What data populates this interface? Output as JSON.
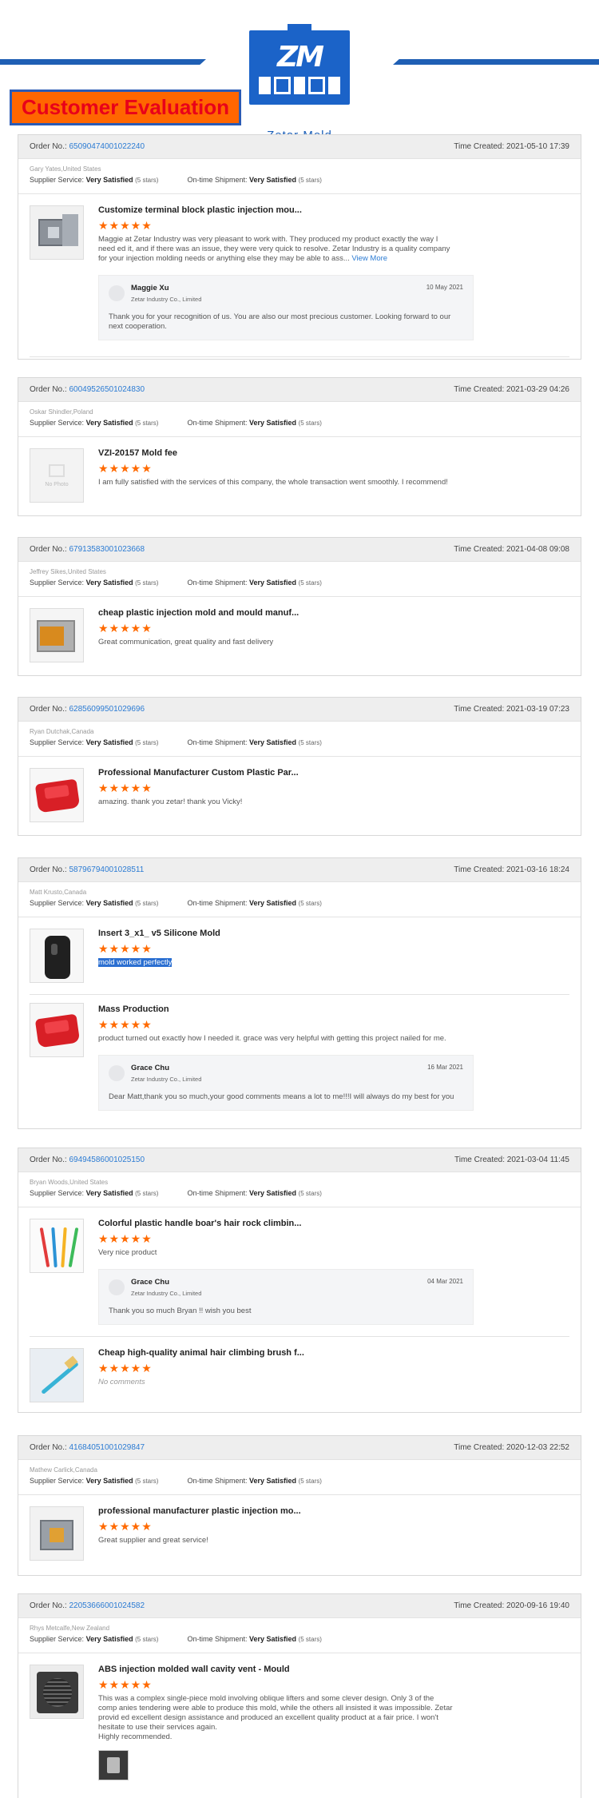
{
  "header": {
    "logo_mark": "ZM",
    "logo_text": "Zetar Mold",
    "banner": "Customer Evaluation"
  },
  "labels": {
    "order_no": "Order No.:",
    "time_created": "Time Created:",
    "supplier_service": "Supplier Service:",
    "ontime_shipment": "On-time Shipment:",
    "view_more": "View More",
    "no_photo": "No Photo"
  },
  "colors": {
    "accent_link": "#2b7bd3",
    "stars": "#ff6a00",
    "banner_bg": "#ff6600",
    "banner_text": "#e8001a",
    "brand_blue": "#1b63c8"
  },
  "orders": [
    {
      "order_no": "65090474001022240",
      "time": "2021-05-10 17:39",
      "buyer": "Gary Yates,United States",
      "supplier_rating": "Very Satisfied",
      "supplier_stars": "(5 stars)",
      "shipment_rating": "On-time Shipment:",
      "shipment_value": "Very Satisfied",
      "shipment_stars": "(5 stars)",
      "items": [
        {
          "thumb_icon": "mold-product-photo",
          "title": "Customize terminal block plastic injection mou...",
          "stars": "★★★★★",
          "text": "Maggie at Zetar Industry was very pleasant to work with. They produced my product exactly the way I need ed it, and if there was an issue, they were very quick to resolve. Zetar Industry is a quality company for your injection molding needs or anything else they may be able to ass...",
          "reply": {
            "name": "Maggie Xu",
            "company": "Zetar Industry Co., Limited",
            "date": "10 May 2021",
            "text": "Thank you for your recognition of us. You are also our most precious customer. Looking forward to our next cooperation."
          }
        }
      ]
    },
    {
      "order_no": "60049526501024830",
      "time": "2021-03-29 04:26",
      "buyer": "Oskar Shindler,Poland",
      "supplier_rating": "Very Satisfied",
      "supplier_stars": "(5 stars)",
      "shipment_value": "Very Satisfied",
      "shipment_stars": "(5 stars)",
      "items": [
        {
          "thumb_icon": "no-photo",
          "title": "VZI-20157 Mold fee",
          "stars": "★★★★★",
          "text": "I am fully satisfied with the services of this company, the whole transaction went smoothly. I recommend!"
        }
      ]
    },
    {
      "order_no": "67913583001023668",
      "time": "2021-04-08 09:08",
      "buyer": "Jeffrey Sikes,United States",
      "supplier_rating": "Very Satisfied",
      "supplier_stars": "(5 stars)",
      "shipment_value": "Very Satisfied",
      "shipment_stars": "(5 stars)",
      "items": [
        {
          "thumb_icon": "mold-photo",
          "title": "cheap plastic injection mold and mould manuf...",
          "stars": "★★★★★",
          "text": "Great communication, great quality and fast delivery"
        }
      ]
    },
    {
      "order_no": "62856099501029696",
      "time": "2021-03-19 07:23",
      "buyer": "Ryan Dutchak,Canada",
      "supplier_rating": "Very Satisfied",
      "supplier_stars": "(5 stars)",
      "shipment_value": "Very Satisfied",
      "shipment_stars": "(5 stars)",
      "items": [
        {
          "thumb_icon": "red-part-photo",
          "title": "Professional Manufacturer Custom Plastic Par...",
          "stars": "★★★★★",
          "text": "amazing.  thank you zetar!   thank you Vicky!"
        }
      ]
    },
    {
      "order_no": "58796794001028511",
      "time": "2021-03-16 18:24",
      "buyer": "Matt Krusto,Canada",
      "supplier_rating": "Very Satisfied",
      "supplier_stars": "(5 stars)",
      "shipment_value": "Very Satisfied",
      "shipment_stars": "(5 stars)",
      "items": [
        {
          "thumb_icon": "black-mold-photo",
          "title": "Insert 3_x1_ v5 Silicone Mold",
          "stars": "★★★★★",
          "text": "mold worked perfectly"
        },
        {
          "thumb_icon": "red-part-photo",
          "title": "Mass Production",
          "stars": "★★★★★",
          "text": "product turned out exactly how I needed it. grace was very helpful with getting this project nailed for me.",
          "reply": {
            "name": "Grace Chu",
            "company": "Zetar Industry Co., Limited",
            "date": "16 Mar 2021",
            "text": "Dear Matt,thank you so much,your good comments means a lot to me!!!I will always do my best for you"
          }
        }
      ]
    },
    {
      "order_no": "69494586001025150",
      "time": "2021-03-04 11:45",
      "buyer": "Bryan Woods,United States",
      "supplier_rating": "Very Satisfied",
      "supplier_stars": "(5 stars)",
      "shipment_value": "Very Satisfied",
      "shipment_stars": "(5 stars)",
      "items": [
        {
          "thumb_icon": "brush-photo",
          "title": "Colorful plastic handle boar's hair rock climbin...",
          "stars": "★★★★★",
          "text": "Very nice product",
          "reply": {
            "name": "Grace Chu",
            "company": "Zetar Industry Co., Limited",
            "date": "04 Mar 2021",
            "text": "Thank you so much Bryan !! wish you best"
          }
        },
        {
          "thumb_icon": "blue-brush-photo",
          "title": "Cheap high-quality animal hair climbing brush f...",
          "stars": "★★★★★",
          "text": "No comments"
        }
      ]
    },
    {
      "order_no": "41684051001029847",
      "time": "2020-12-03 22:52",
      "buyer": "Mathew Carlick,Canada",
      "supplier_rating": "Very Satisfied",
      "supplier_stars": "(5 stars)",
      "shipment_value": "Very Satisfied",
      "shipment_stars": "(5 stars)",
      "items": [
        {
          "thumb_icon": "mold-photo",
          "title": "professional manufacturer plastic injection mo...",
          "stars": "★★★★★",
          "text": "Great supplier and great service!"
        }
      ]
    },
    {
      "order_no": "22053666001024582",
      "time": "2020-09-16 19:40",
      "buyer": "Rhys Metcalfe,New Zealand",
      "supplier_rating": "Very Satisfied",
      "supplier_stars": "(5 stars)",
      "shipment_value": "Very Satisfied",
      "shipment_stars": "(5 stars)",
      "items": [
        {
          "thumb_icon": "vent-photo",
          "title": "ABS injection molded wall cavity vent - Mould",
          "stars": "★★★★★",
          "text": "This was a complex single-piece mold involving oblique lifters and some clever design.  Only 3 of the comp anies tendering were able to produce this mold, while the others all insisted it was impossible.  Zetar provid ed excellent design assistance and produced an excellent quality product at a fair price.  I won't hesitate to use their services again.",
          "text2": "Highly recommended."
        }
      ]
    }
  ]
}
